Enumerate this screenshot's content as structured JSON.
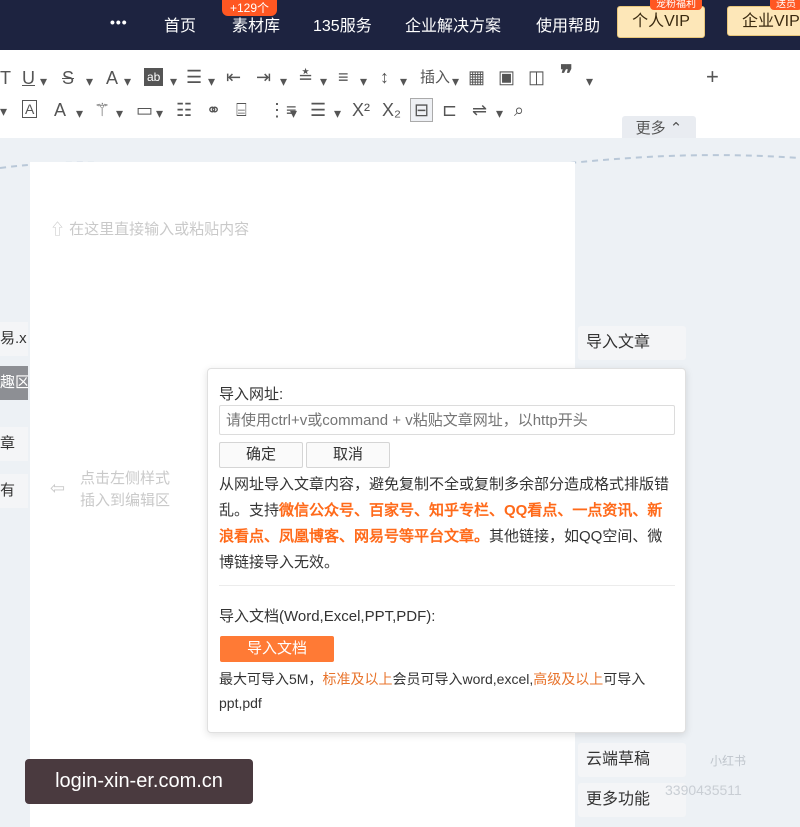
{
  "nav": {
    "items": [
      "首页",
      "素材库",
      "135服务",
      "企业解决方案",
      "使用帮助"
    ],
    "badge": "+129个",
    "vip_personal": "个人VIP",
    "vip_personal_tag": "宠粉福利",
    "vip_enterprise": "企业VIP",
    "vip_enterprise_tag": "送员"
  },
  "toolbar": {
    "insert_label": "插入",
    "more_label": "更多"
  },
  "editor": {
    "hint": "在这里直接输入或粘贴内容",
    "left_hint_line1": "点击左侧样式",
    "left_hint_line2": "插入到编辑区"
  },
  "left_tabs": [
    "易.x",
    "趣区",
    "章",
    "有"
  ],
  "side_buttons": {
    "import_article": "导入文章",
    "cloud_draft": "云端草稿",
    "more_functions": "更多功能"
  },
  "import_popup": {
    "url_label": "导入网址:",
    "url_placeholder": "请使用ctrl+v或command + v粘贴文章网址，以http开头",
    "confirm_label": "确定",
    "cancel_label": "取消",
    "desc_part1": "从网址导入文章内容，避免复制不全或复制多余部分造成格式排版错乱。支持",
    "desc_highlight": "微信公众号、百家号、知乎专栏、QQ看点、一点资讯、新浪看点、凤凰博客、网易号等平台文章。",
    "desc_part2": "其他链接，如QQ空间、微博链接导入无效。",
    "doc_label": "导入文档(Word,Excel,PPT,PDF):",
    "upload_label": "导入文档",
    "size_part1": "最大可导入5M，",
    "size_highlight1": "标准及以上",
    "size_part2": "会员可导入word,excel,",
    "size_highlight2": "高级及以上",
    "size_part3": "可导入ppt,pdf"
  },
  "watermark": {
    "text": "login-xin-er.com.cn",
    "xhs_logo": "小红书",
    "xhs_id": "3390435511"
  },
  "colors": {
    "nav_bg": "#1d2340",
    "accent_orange": "#ff7a35",
    "highlight": "#ff6a1a",
    "vip_bg": "#fde7b8"
  }
}
